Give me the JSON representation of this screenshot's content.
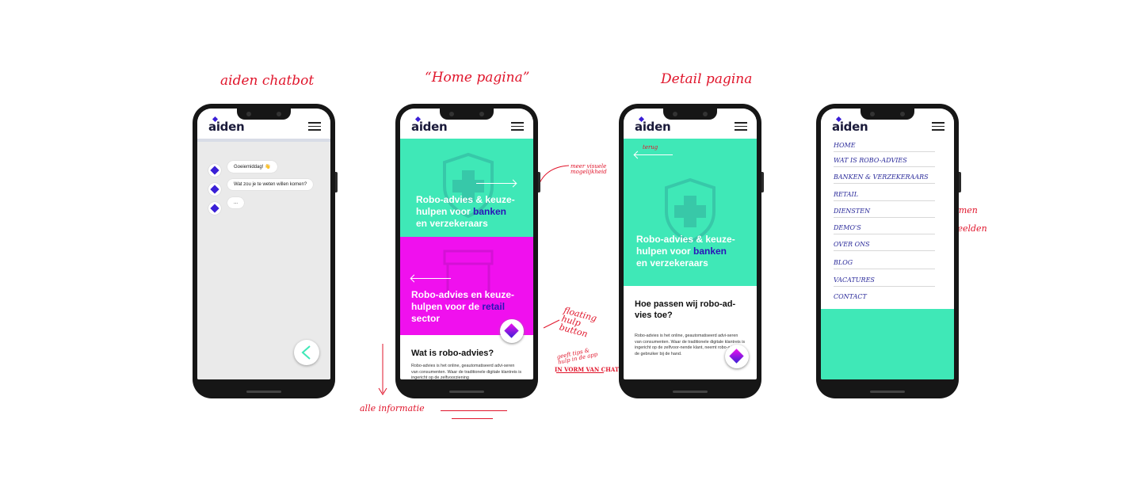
{
  "notes": {
    "chatbot": "aiden chatbot",
    "home": "“Home pagina”",
    "detail": "Detail pagina",
    "meer": "meer visuele mogelijkheid",
    "floating": "floating hulp button",
    "tips": "geeft tips & hulp in de app",
    "chat": "IN VORM VAN CHAT",
    "alle": "alle informatie",
    "platformen": "Platformen",
    "voorbeelden": "Voorbeelden"
  },
  "brand": {
    "logo": "aiden",
    "green": "#3fe8b7",
    "magenta": "#f010ee",
    "accent": "#3a1fd6"
  },
  "chat": {
    "messages": [
      "Goeiemiddag! 👋",
      "Wat zou je te weten willen komen?",
      "..."
    ]
  },
  "home": {
    "panel1": {
      "t1": "Robo-advies & keuze-",
      "t2": "hulpen voor ",
      "hl1": "banken",
      "t3": "en verzekeraars"
    },
    "panel2": {
      "t1": "Robo-advies en keuze-",
      "t2": "hulpen voor de ",
      "hl1": "retail",
      "t3": "sector"
    },
    "section_title": "Wat is robo-advies?",
    "section_text": "Robo-advies is het online, geautomatiseerd advi-seren van consumenten. Waar de traditionele digitale klantreis is ingericht op de zelfvoorziening"
  },
  "detail": {
    "back": "terug",
    "panel": {
      "t1": "Robo-advies & keuze-",
      "t2": "hulpen voor ",
      "hl1": "banken",
      "t3": "en verzekeraars"
    },
    "section_title": "Hoe passen wij robo-ad-vies toe?",
    "section_text": "Robo-advies is het online, geautomatiseerd advi-seren van consumenten. Waar de traditionele digitale klantreis is ingericht op de zelfvoor-nende klant, neemt robo-advies de gebruiker bij de hand."
  },
  "menu": {
    "items": [
      "Home",
      "Wat is robo-advies",
      "Banken & verzekeraars",
      "Retail",
      "Diensten",
      "Demo's",
      "Over ons",
      "Blog",
      "Vacatures",
      "Contact"
    ]
  }
}
